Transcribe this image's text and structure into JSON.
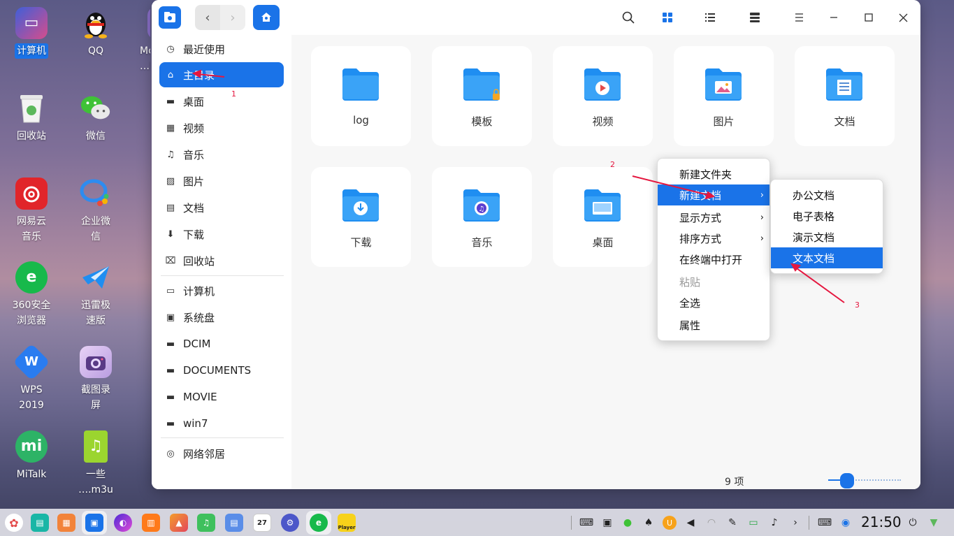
{
  "desktop": {
    "icons": [
      {
        "label": "计算机",
        "icon": "computer-icon"
      },
      {
        "label": "QQ",
        "icon": "qq-penguin-icon"
      },
      {
        "label": "Mc\n…l",
        "icon": "partial-file-icon"
      },
      {
        "label": "回收站",
        "icon": "trash-icon"
      },
      {
        "label": "微信",
        "icon": "wechat-icon"
      },
      {
        "label": "网易云\n音乐",
        "icon": "netease-music-icon"
      },
      {
        "label": "企业微\n信",
        "icon": "wecom-icon"
      },
      {
        "label": "360安全\n浏览器",
        "icon": "360-browser-icon"
      },
      {
        "label": "迅雷极\n速版",
        "icon": "xunlei-icon"
      },
      {
        "label": "WPS\n2019",
        "icon": "wps-icon"
      },
      {
        "label": "截图录\n屏",
        "icon": "screenshot-camera-icon"
      },
      {
        "label": "MiTalk",
        "icon": "mitalk-icon"
      },
      {
        "label": "一些\n….m3u",
        "icon": "m3u-file-icon"
      }
    ]
  },
  "sidebar": {
    "items": [
      {
        "label": "最近使用",
        "icon": "clock-icon"
      },
      {
        "label": "主目录",
        "icon": "home-icon"
      },
      {
        "label": "桌面",
        "icon": "desktop-icon"
      },
      {
        "label": "视频",
        "icon": "video-icon"
      },
      {
        "label": "音乐",
        "icon": "music-icon"
      },
      {
        "label": "图片",
        "icon": "image-icon"
      },
      {
        "label": "文档",
        "icon": "document-icon"
      },
      {
        "label": "下载",
        "icon": "download-icon"
      },
      {
        "label": "回收站",
        "icon": "trash-icon"
      },
      {
        "label": "计算机",
        "icon": "computer-icon"
      },
      {
        "label": "系统盘",
        "icon": "system-disk-icon"
      },
      {
        "label": "DCIM",
        "icon": "drive-icon"
      },
      {
        "label": "DOCUMENTS",
        "icon": "drive-icon"
      },
      {
        "label": "MOVIE",
        "icon": "drive-icon"
      },
      {
        "label": "win7",
        "icon": "drive-icon"
      },
      {
        "label": "网络邻居",
        "icon": "network-icon"
      }
    ]
  },
  "main": {
    "folders": [
      {
        "label": "log",
        "badge": ""
      },
      {
        "label": "模板",
        "badge": "lock"
      },
      {
        "label": "视频",
        "badge": "play"
      },
      {
        "label": "图片",
        "badge": "picture"
      },
      {
        "label": "文档",
        "badge": "doc"
      },
      {
        "label": "下载",
        "badge": "download"
      },
      {
        "label": "音乐",
        "badge": "music"
      },
      {
        "label": "桌面",
        "badge": "desktop"
      }
    ],
    "status": "9 项",
    "zoom_level": 0.25
  },
  "context_menu": {
    "items": [
      "新建文件夹",
      "新建文档",
      "显示方式",
      "排序方式",
      "在终端中打开",
      "粘贴",
      "全选",
      "属性"
    ],
    "submenu": [
      "办公文档",
      "电子表格",
      "演示文档",
      "文本文档"
    ]
  },
  "annotations": {
    "a1": "1",
    "a2": "2",
    "a3": "3"
  },
  "taskbar": {
    "clock": "21:50",
    "calendar_day": "27",
    "player_label": "Player"
  },
  "colors": {
    "accent": "#1a73e8",
    "annotation": "#e5173f",
    "folder": "#2a9af3"
  }
}
